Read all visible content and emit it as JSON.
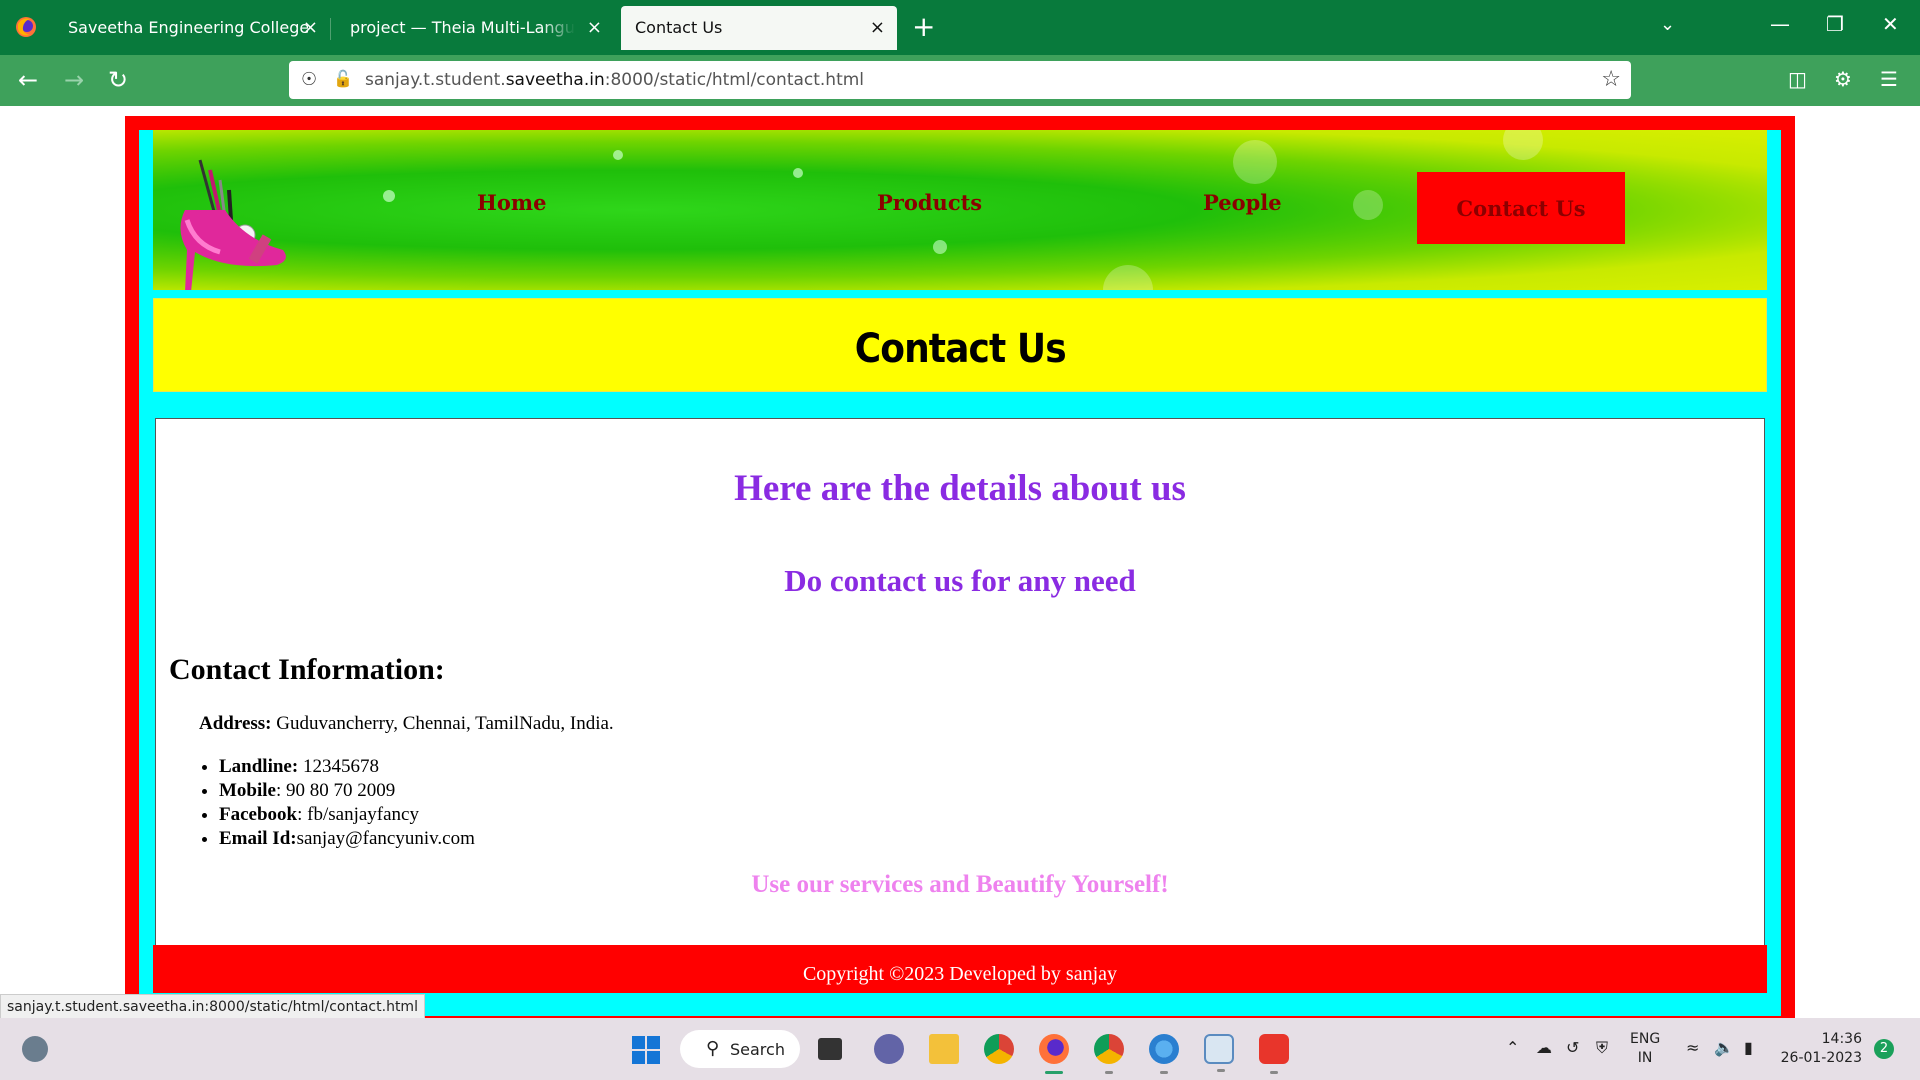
{
  "browser": {
    "tabs": [
      {
        "title": "Saveetha Engineering College"
      },
      {
        "title": "project — Theia Multi-Language Ex"
      },
      {
        "title": "Contact Us"
      }
    ],
    "close_glyph": "×",
    "new_tab_glyph": "+",
    "url_prefix": "sanjay.t.student.",
    "url_domain": "saveetha.in",
    "url_suffix": ":8000/static/html/contact.html",
    "accent_color": "#087a3c",
    "toolbar_color": "#3ea15b"
  },
  "page": {
    "nav": {
      "home": "Home",
      "products": "Products",
      "people": "People",
      "contact": "Contact Us"
    },
    "title": "Contact Us",
    "heading_details": "Here are the details about us",
    "heading_contact": "Do contact us for any need",
    "info_title": "Contact Information:",
    "address_label": "Address:",
    "address_value": " Guduvancherry, Chennai, TamilNadu, India.",
    "contacts": [
      {
        "label": "Landline:",
        "value": " 12345678"
      },
      {
        "label": "Mobile",
        "value": ": 90 80 70 2009"
      },
      {
        "label": "Facebook",
        "value": ": fb/sanjayfancy"
      },
      {
        "label": "Email Id:",
        "value": "sanjay@fancyuniv.com"
      }
    ],
    "slogan": "Use our services and Beautify Yourself!",
    "footer": "Copyright ©2023 Developed by sanjay",
    "colors": {
      "outer_border": "#ff0000",
      "inner_border": "#00ffff",
      "title_bg": "#ffff00",
      "heading": "#8a2be2",
      "slogan": "#ee82ee",
      "nav_text": "#8b0000"
    }
  },
  "status_url": "sanjay.t.student.saveetha.in:8000/static/html/contact.html",
  "taskbar": {
    "search_label": "Search",
    "lang_line1": "ENG",
    "lang_line2": "IN",
    "time": "14:36",
    "date": "26-01-2023",
    "notification_count": "2",
    "apps": [
      "task-view-icon",
      "chat-icon",
      "file-explorer-icon",
      "chrome-icon",
      "firefox-icon",
      "chrome-profile-icon",
      "paint-icon",
      "notepad-icon",
      "wps-office-icon"
    ]
  }
}
